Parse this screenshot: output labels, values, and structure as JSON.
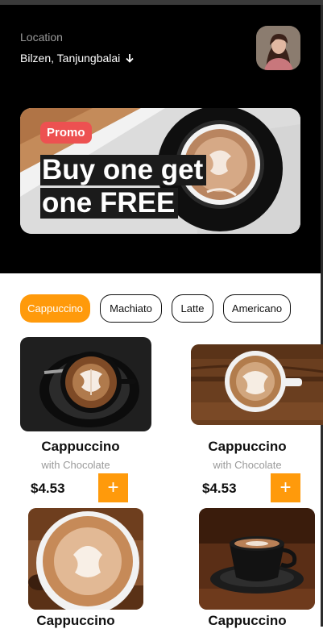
{
  "location": {
    "label": "Location",
    "value": "Bilzen, Tanjungbalai"
  },
  "banner": {
    "badge": "Promo",
    "line1": "Buy one get",
    "line2": "one FREE"
  },
  "categories": [
    {
      "label": "Cappuccino",
      "active": true
    },
    {
      "label": "Machiato",
      "active": false
    },
    {
      "label": "Latte",
      "active": false
    },
    {
      "label": "Americano",
      "active": false
    }
  ],
  "products": [
    {
      "name": "Cappuccino",
      "subtitle": "with Chocolate",
      "price": "$4.53",
      "add_label": "+"
    },
    {
      "name": "Cappuccino",
      "subtitle": "with Chocolate",
      "price": "$4.53",
      "add_label": "+"
    },
    {
      "name": "Cappuccino"
    },
    {
      "name": "Cappuccino"
    }
  ],
  "colors": {
    "accent": "#ff9a0b",
    "promo": "#ed5151",
    "header_bg": "#000000"
  }
}
